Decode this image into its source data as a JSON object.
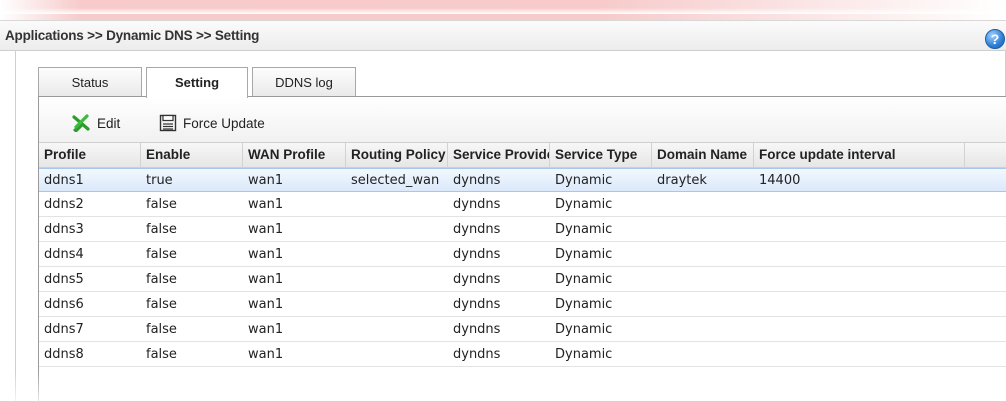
{
  "breadcrumb": "Applications >> Dynamic DNS >> Setting",
  "help_icon_glyph": "?",
  "tabs": [
    {
      "label": "Status",
      "active": false
    },
    {
      "label": "Setting",
      "active": true
    },
    {
      "label": "DDNS log",
      "active": false
    }
  ],
  "toolbar": {
    "edit_label": "Edit",
    "force_update_label": "Force Update"
  },
  "columns": [
    "Profile",
    "Enable",
    "WAN Profile",
    "Routing Policy",
    "Service Provider",
    "Service Type",
    "Domain Name",
    "Force update interval"
  ],
  "rows": [
    [
      "ddns1",
      "true",
      "wan1",
      "selected_wan",
      "dyndns",
      "Dynamic",
      "draytek",
      "14400"
    ],
    [
      "ddns2",
      "false",
      "wan1",
      "",
      "dyndns",
      "Dynamic",
      "",
      ""
    ],
    [
      "ddns3",
      "false",
      "wan1",
      "",
      "dyndns",
      "Dynamic",
      "",
      ""
    ],
    [
      "ddns4",
      "false",
      "wan1",
      "",
      "dyndns",
      "Dynamic",
      "",
      ""
    ],
    [
      "ddns5",
      "false",
      "wan1",
      "",
      "dyndns",
      "Dynamic",
      "",
      ""
    ],
    [
      "ddns6",
      "false",
      "wan1",
      "",
      "dyndns",
      "Dynamic",
      "",
      ""
    ],
    [
      "ddns7",
      "false",
      "wan1",
      "",
      "dyndns",
      "Dynamic",
      "",
      ""
    ],
    [
      "ddns8",
      "false",
      "wan1",
      "",
      "dyndns",
      "Dynamic",
      "",
      ""
    ]
  ],
  "colors": {
    "selected_row": "#dbe9fb",
    "edit_icon": "#2ca02c"
  }
}
